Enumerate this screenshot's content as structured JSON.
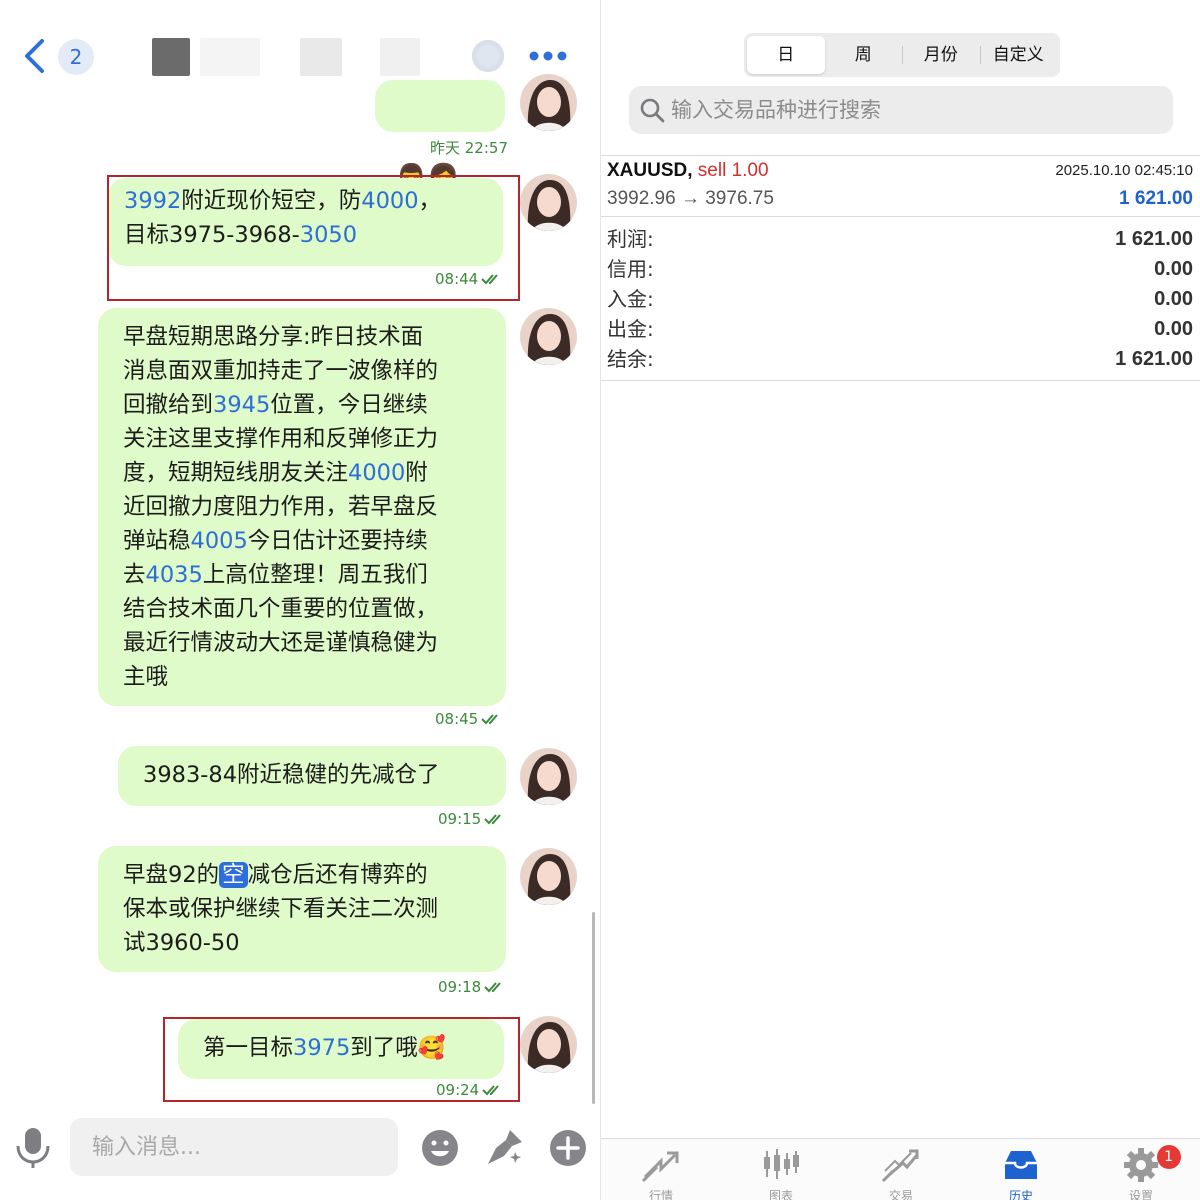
{
  "chat": {
    "header": {
      "unread_count": "2"
    },
    "messages": [
      {
        "id": "m0",
        "emoji": "👨‍👩👨‍👩",
        "time": "昨天 22:57"
      },
      {
        "id": "m1",
        "parts": [
          {
            "t": "3992",
            "n": true
          },
          {
            "t": "附近现价短空，防"
          },
          {
            "t": "4000",
            "n": true
          },
          {
            "t": "，\n目标3975-3968-"
          },
          {
            "t": "3050",
            "n": true
          }
        ],
        "time": "08:44"
      },
      {
        "id": "m2",
        "parts": [
          {
            "t": "早盘短期思路分享:昨日技术面\n消息面双重加持走了一波像样的\n回撤给到"
          },
          {
            "t": "3945",
            "n": true
          },
          {
            "t": "位置，今日继续\n关注这里支撑作用和反弹修正力\n度，短期短线朋友关注"
          },
          {
            "t": "4000",
            "n": true
          },
          {
            "t": "附\n近回撤力度阻力作用，若早盘反\n弹站稳"
          },
          {
            "t": "4005",
            "n": true
          },
          {
            "t": "今日估计还要持续\n去"
          },
          {
            "t": "4035",
            "n": true
          },
          {
            "t": "上高位整理！周五我们\n结合技术面几个重要的位置做，\n最近行情波动大还是谨慎稳健为\n主哦"
          }
        ],
        "time": "08:45"
      },
      {
        "id": "m3",
        "parts": [
          {
            "t": "3983-84附近稳健的先减仓了"
          }
        ],
        "time": "09:15"
      },
      {
        "id": "m4",
        "parts": [
          {
            "t": "早盘92的"
          },
          {
            "t": "空",
            "badge": true
          },
          {
            "t": "减仓后还有博弈的\n保本或保护继续下看关注二次测\n试3960-50"
          }
        ],
        "time": "09:18"
      },
      {
        "id": "m5",
        "parts": [
          {
            "t": "第一目标"
          },
          {
            "t": "3975",
            "n": true
          },
          {
            "t": "到了哦🥰"
          }
        ],
        "time": "09:24"
      }
    ],
    "input_placeholder": "输入消息..."
  },
  "trade": {
    "periods": [
      "日",
      "周",
      "月份",
      "自定义"
    ],
    "active_period": "日",
    "search_placeholder": "输入交易品种进行搜索",
    "deal": {
      "symbol": "XAUUSD,",
      "direction": "sell 1.00",
      "time": "2025.10.10 02:45:10",
      "prices": "3992.96 → 3976.75",
      "profit": "1 621.00"
    },
    "summary": [
      {
        "label": "利润:",
        "value": "1 621.00"
      },
      {
        "label": "信用:",
        "value": "0.00"
      },
      {
        "label": "入金:",
        "value": "0.00"
      },
      {
        "label": "出金:",
        "value": "0.00"
      },
      {
        "label": "结余:",
        "value": "1 621.00"
      }
    ],
    "tabs": [
      {
        "label": "行情",
        "icon": "quotes-icon"
      },
      {
        "label": "图表",
        "icon": "chart-icon"
      },
      {
        "label": "交易",
        "icon": "trade-icon"
      },
      {
        "label": "历史",
        "icon": "history-icon",
        "active": true
      },
      {
        "label": "设置",
        "icon": "settings-icon",
        "badge": "1"
      }
    ]
  },
  "colors": {
    "bubble": "#dffbc9",
    "link_number": "#2e6ed8",
    "timestamp": "#3c8a3c",
    "highlight": "#b3262c",
    "sell": "#d32f2f",
    "profit": "#1e62d0"
  }
}
